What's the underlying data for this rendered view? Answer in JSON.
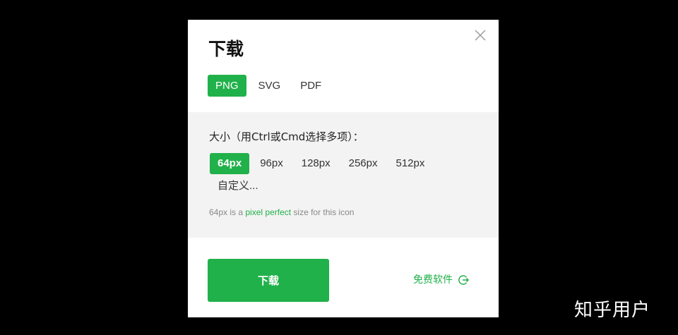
{
  "dialog": {
    "title": "下载",
    "close_icon": "close-icon",
    "formats": [
      {
        "label": "PNG",
        "active": true
      },
      {
        "label": "SVG",
        "active": false
      },
      {
        "label": "PDF",
        "active": false
      }
    ],
    "size_label": "大小（用Ctrl或Cmd选择多项）：",
    "sizes": [
      {
        "label": "64px",
        "active": true
      },
      {
        "label": "96px",
        "active": false
      },
      {
        "label": "128px",
        "active": false
      },
      {
        "label": "256px",
        "active": false
      },
      {
        "label": "512px",
        "active": false
      },
      {
        "label": "自定义...",
        "active": false
      }
    ],
    "note": {
      "prefix": "64px is a ",
      "link": "pixel perfect",
      "suffix": " size for this icon"
    },
    "download_label": "下载",
    "free_software_label": "免费软件",
    "free_software_icon": "external-arrow-icon"
  },
  "watermark": "知乎用户",
  "colors": {
    "accent": "#21b14a",
    "backdrop": "#000000",
    "panel": "#f3f3f3"
  }
}
